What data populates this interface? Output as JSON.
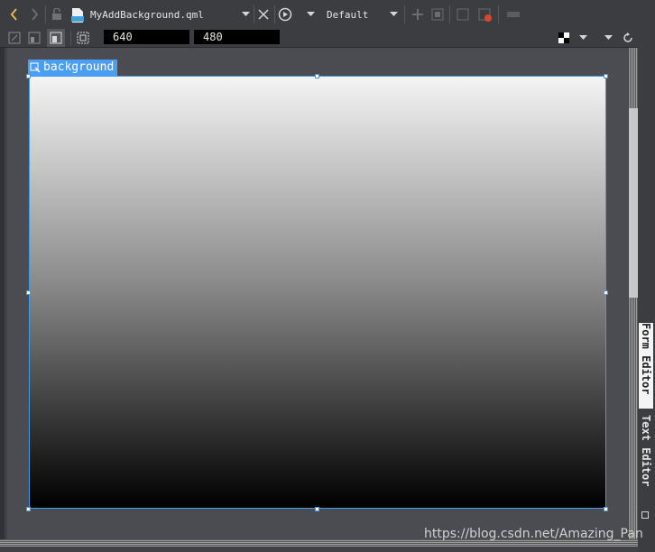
{
  "toolbar": {
    "file_name": "MyAddBackground.qml",
    "file_icon_label": "qml",
    "state_combo_value": "Default",
    "icons": {
      "back": "chevron-left-icon",
      "forward": "chevron-right-icon",
      "lock": "lock-icon",
      "file": "qml-file-icon",
      "file_dropdown": "dropdown-arrow-icon",
      "close": "close-icon",
      "live_preview": "play-circle-icon",
      "live_dropdown": "dropdown-arrow-icon",
      "state_dropdown": "dropdown-arrow-icon"
    }
  },
  "toolbar2": {
    "width_value": "640",
    "height_value": "480"
  },
  "canvas": {
    "item_label": "background",
    "gradient_top": "#f4f4f4",
    "gradient_bottom": "#000000",
    "selection_color": "#3f9bf0"
  },
  "side_tabs": {
    "form_editor": "Form Editor",
    "text_editor": "Text Editor"
  },
  "watermark": "https://blog.csdn.net/Amazing_Pan"
}
